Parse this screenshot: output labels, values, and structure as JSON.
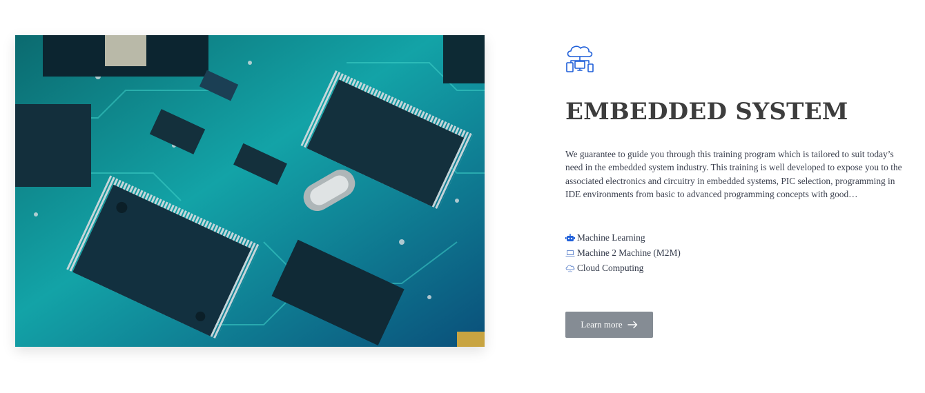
{
  "hero_image": {
    "subject": "circuit-board-photo"
  },
  "service": {
    "icon": "cloud-devices-icon",
    "title": "EMBEDDED SYSTEM",
    "description": "We guarantee to guide you through this training program which is tailored to suit today’s need in the embedded system industry. This training is well developed to expose you to the associated electronics and circuitry in embedded systems, PIC selection, programming in IDE environments from basic to advanced programming concepts with good…",
    "features": [
      {
        "icon": "robot-icon",
        "label": "Machine Learning"
      },
      {
        "icon": "laptop-icon",
        "label": "Machine 2 Machine (M2M)"
      },
      {
        "icon": "cloud-icon",
        "label": "Cloud Computing"
      }
    ],
    "button": {
      "label": "Learn more",
      "icon": "arrow-right-icon"
    }
  },
  "colors": {
    "accent": "#1f5fd9",
    "button_bg": "#858c94",
    "title": "#3d3d3d"
  }
}
